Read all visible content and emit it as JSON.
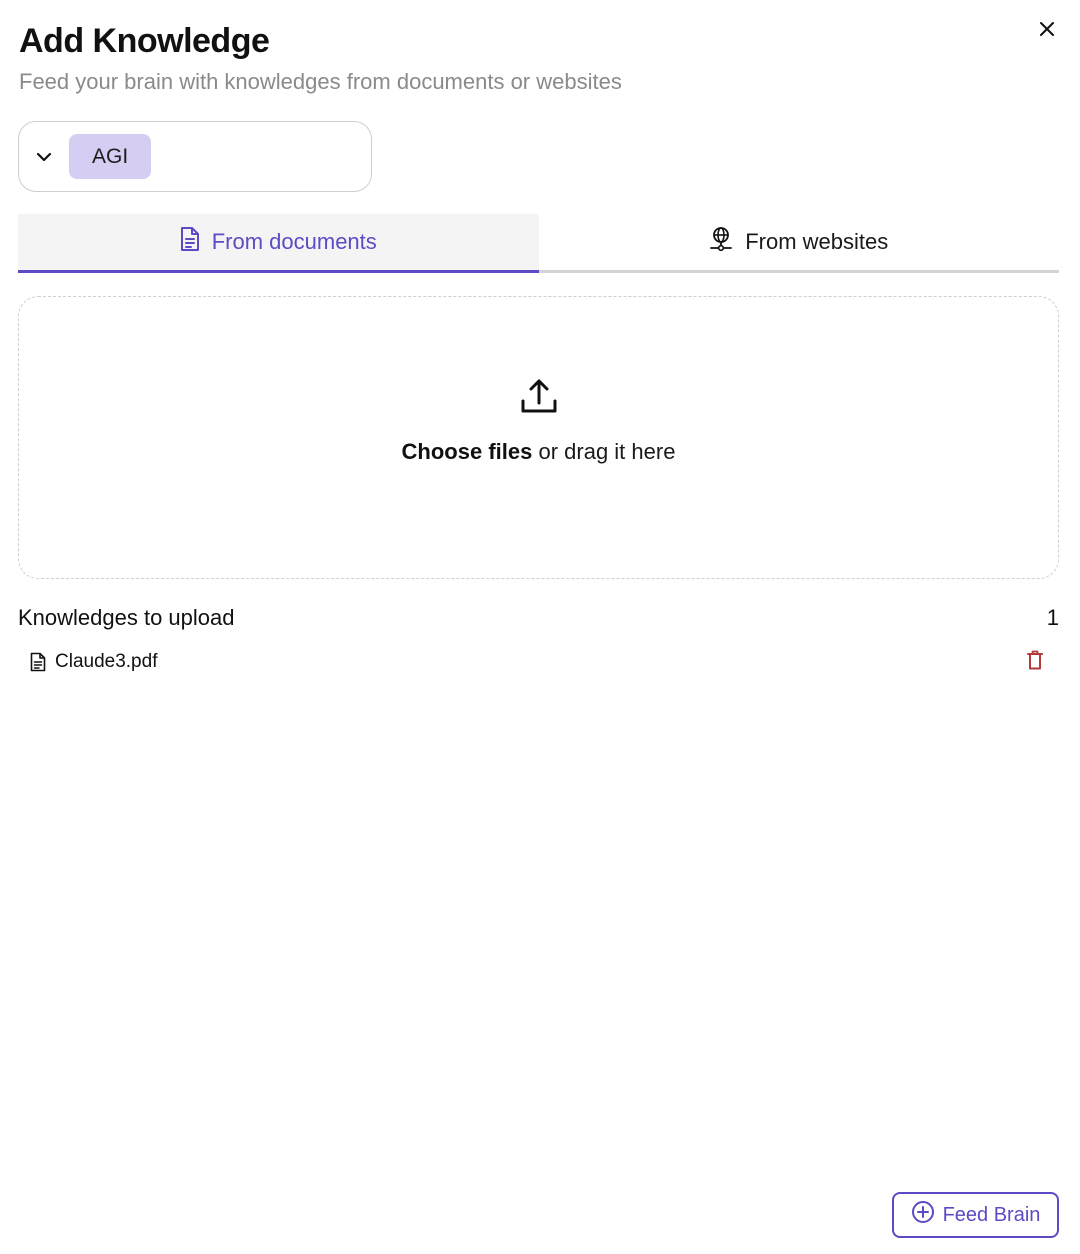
{
  "modal": {
    "title": "Add Knowledge",
    "subtitle": "Feed your brain with knowledges from documents or websites",
    "close_icon": "close-icon"
  },
  "brain_selector": {
    "icon": "chevron-down-icon",
    "selected": "AGI",
    "chip_color": "#d6cdf3"
  },
  "tabs": [
    {
      "label": "From documents",
      "icon": "document-icon",
      "active": true
    },
    {
      "label": "From websites",
      "icon": "globe-icon",
      "active": false
    }
  ],
  "dropzone": {
    "icon": "upload-icon",
    "action_label": "Choose files",
    "hint": " or drag it here"
  },
  "uploads": {
    "header": "Knowledges to upload",
    "count": "1",
    "files": [
      {
        "name": "Claude3.pdf",
        "icon": "file-icon",
        "delete_icon": "trash-icon"
      }
    ]
  },
  "footer": {
    "feed_label": "Feed Brain",
    "feed_icon": "plus-circle-icon"
  },
  "colors": {
    "accent": "#5b4bc4",
    "danger": "#b23a3a",
    "muted_text": "#8a8a8a"
  }
}
